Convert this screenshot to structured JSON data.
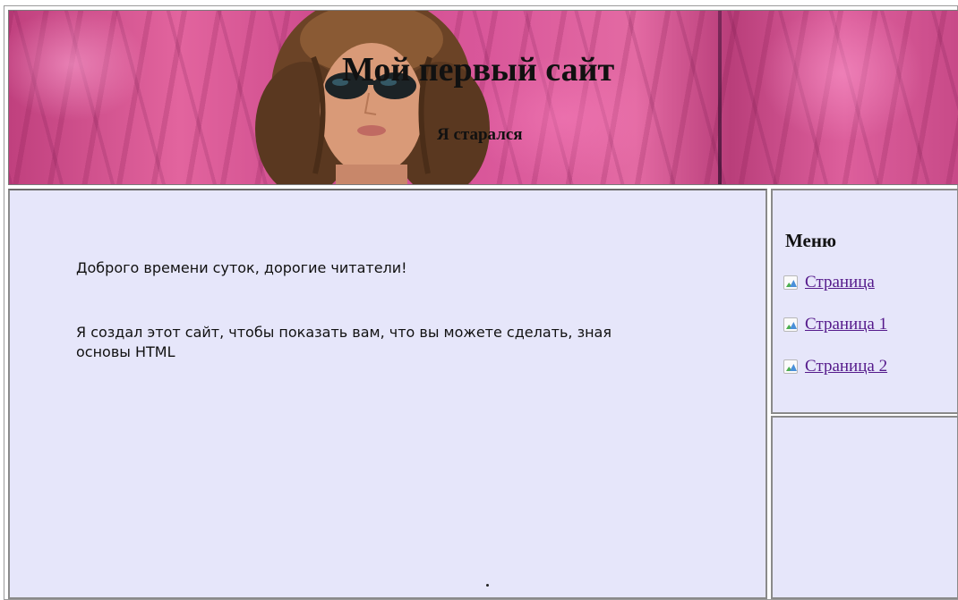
{
  "header": {
    "title": "Мой первый сайт",
    "subtitle": "Я старался"
  },
  "content": {
    "greeting": "Доброго времени суток, дорогие читатели!",
    "body": "Я создал этот сайт, чтобы показать вам, что вы можете сделать, зная основы HTML",
    "footer_mark": "."
  },
  "sidebar": {
    "menu_title": "Меню",
    "items": [
      {
        "label": "Страница",
        "icon": "broken-image-icon"
      },
      {
        "label": "Страница 1",
        "icon": "broken-image-icon"
      },
      {
        "label": "Страница 2",
        "icon": "broken-image-icon"
      }
    ]
  },
  "colors": {
    "panel_background": "#e6e6fa",
    "link": "#551a8b",
    "header_accent": "#d9579a"
  }
}
